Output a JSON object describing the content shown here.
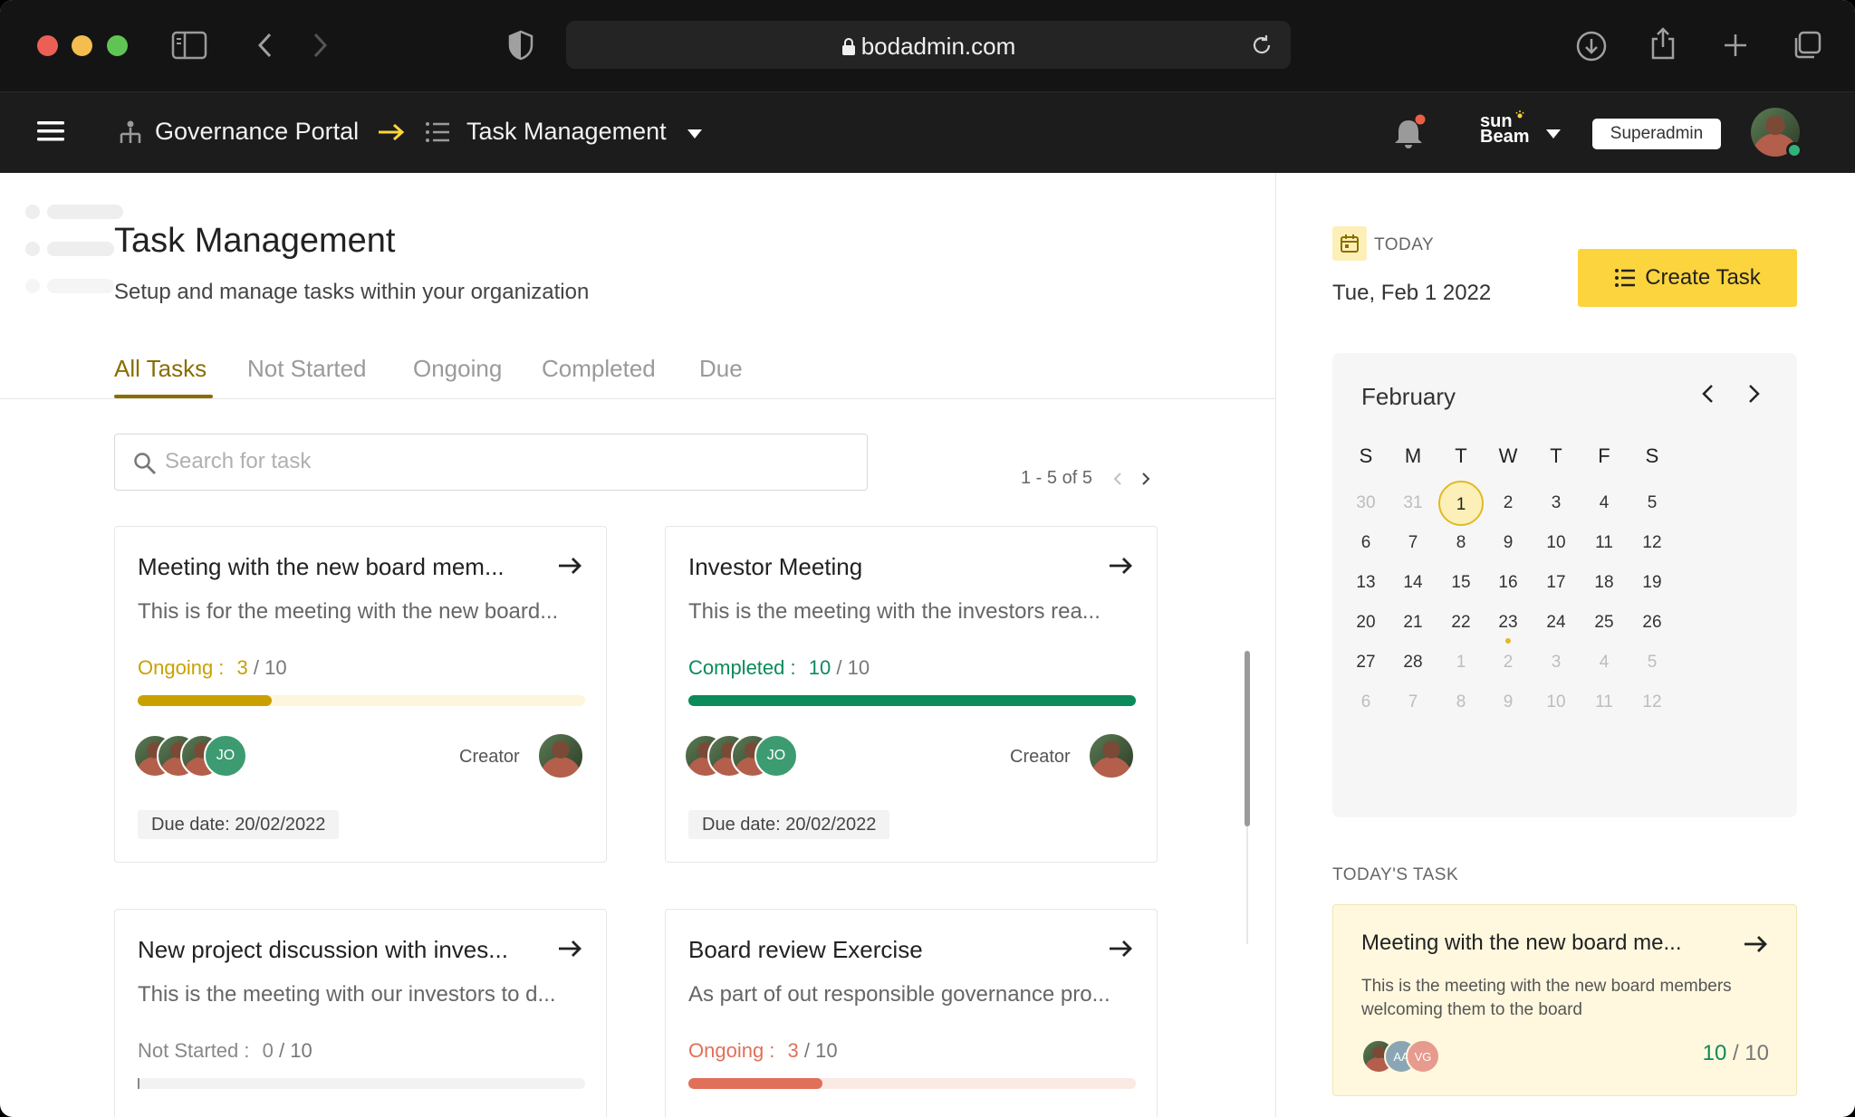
{
  "browser": {
    "url": "bodadmin.com"
  },
  "appbar": {
    "portal": "Governance Portal",
    "section": "Task Management",
    "brand_line1": "sun",
    "brand_line2": "Beam",
    "role": "Superadmin"
  },
  "page": {
    "title": "Task Management",
    "subtitle": "Setup and manage tasks within your organization"
  },
  "tabs": [
    {
      "label": "All Tasks",
      "active": true
    },
    {
      "label": "Not Started",
      "active": false
    },
    {
      "label": "Ongoing",
      "active": false
    },
    {
      "label": "Completed",
      "active": false
    },
    {
      "label": "Due",
      "active": false
    }
  ],
  "search": {
    "placeholder": "Search for task",
    "value": ""
  },
  "pager": {
    "text": "1 - 5 of 5"
  },
  "tasks": [
    {
      "title": "Meeting with the new board mem...",
      "desc": "This is for the meeting with the new board...",
      "status": "Ongoing :",
      "done": "3",
      "total": "/ 10",
      "progress": 0.3,
      "status_color": "#c9a000",
      "track_color": "#fdf6dc",
      "initials": "JO",
      "creator_label": "Creator",
      "due": "Due date: 20/02/2022"
    },
    {
      "title": "Investor Meeting",
      "desc": "This is the meeting with the investors rea...",
      "status": "Completed :",
      "done": "10",
      "total": "/ 10",
      "progress": 1.0,
      "status_color": "#0b8a5a",
      "track_color": "#dff2ea",
      "initials": "JO",
      "creator_label": "Creator",
      "due": "Due date: 20/02/2022"
    },
    {
      "title": "New project discussion with inves...",
      "desc": "This is the meeting with our investors to d...",
      "status": "Not Started :",
      "done": "0",
      "total": "/ 10",
      "progress": 0.0,
      "status_color": "#888888",
      "track_color": "#f2f2f2"
    },
    {
      "title": "Board review Exercise",
      "desc": "As part of out responsible governance pro...",
      "status": "Ongoing :",
      "done": "3",
      "total": "/ 10",
      "progress": 0.3,
      "status_color": "#e0705a",
      "track_color": "#fbe9e4"
    }
  ],
  "sidebar": {
    "today_label": "TODAY",
    "today_date": "Tue, Feb 1 2022",
    "create_button": "Create Task",
    "calendar": {
      "month": "February",
      "dow": [
        "S",
        "M",
        "T",
        "W",
        "T",
        "F",
        "S"
      ],
      "weeks": [
        [
          "30",
          "31",
          "1",
          "2",
          "3",
          "4",
          "5"
        ],
        [
          "6",
          "7",
          "8",
          "9",
          "10",
          "11",
          "12"
        ],
        [
          "13",
          "14",
          "15",
          "16",
          "17",
          "18",
          "19"
        ],
        [
          "20",
          "21",
          "22",
          "23",
          "24",
          "25",
          "26"
        ],
        [
          "27",
          "28",
          "1",
          "2",
          "3",
          "4",
          "5"
        ],
        [
          "6",
          "7",
          "8",
          "9",
          "10",
          "11",
          "12"
        ]
      ],
      "selected": "1"
    },
    "todays_task_label": "TODAY'S TASK",
    "todays_task": {
      "title": "Meeting with the new board me...",
      "desc": "This is the meeting with the new board members welcoming them to the board",
      "avatar_1": "AA",
      "avatar_2": "VG",
      "done": "10",
      "total": "/ 10"
    }
  }
}
